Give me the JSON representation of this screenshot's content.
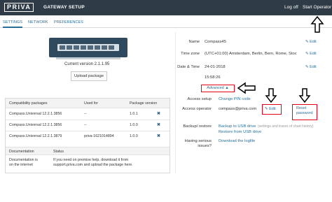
{
  "header": {
    "logo": "PRIVA",
    "title": "GATEWAY SETUP",
    "log_off": "Log off",
    "start_operator": "Start Operator"
  },
  "tabs": [
    {
      "label": "SETTINGS"
    },
    {
      "label": "NETWORK"
    },
    {
      "label": "PREFERENCES"
    }
  ],
  "device": {
    "current_version": "Current version 2.1.1.95",
    "upload_label": "Upload package"
  },
  "packages": {
    "headers": [
      "Compatibility packages",
      "Used for",
      "Package version"
    ],
    "rows": [
      {
        "name": "Compass.Universal 12.2.1.3856",
        "used_for": "--",
        "version": "1.0.1"
      },
      {
        "name": "Compass.Universal 12.2.1.3856",
        "used_for": "--",
        "version": "1.0.0"
      },
      {
        "name": "Compass.Universal 12.2.1.3879",
        "used_for": "priva-1621014894",
        "version": "1.0.0"
      }
    ]
  },
  "documentation": {
    "headers": [
      "Documentation",
      "Status"
    ],
    "label_line1": "Documentation is",
    "label_line2": "on the internet",
    "status_line1": "If you need on premise help, download it from",
    "status_line2": "support.priva.com and upload the package here."
  },
  "settings": {
    "name_label": "Name",
    "name_value": "Compass45",
    "timezone_label": "Time zone",
    "timezone_value": "(UTC+01:00) Amsterdam, Berlin, Bern, Rome, Stock",
    "datetime_label": "Date & Time",
    "date_value": "24-01-2018",
    "time_value": "15:58:26",
    "edit_label": "Edit",
    "advanced_label": "Advanced ▲",
    "access_setup_label": "Access setup",
    "access_setup_value": "Change PIN code",
    "access_operator_label": "Access operator",
    "access_operator_value": "compass@priva.com",
    "reset_line1": "Reset",
    "reset_line2": "password",
    "backup_label": "Backup/ restore",
    "backup_link": "Backup to USB drive",
    "backup_note": "(settings and traces of chart history)",
    "restore_link": "Restore from USB drive",
    "issues_label_line1": "Having serious",
    "issues_label_line2": "issues?",
    "logfile_link": "Download the logfile"
  },
  "colors": {
    "topbar": "#2f3b47",
    "link": "#2a6f97",
    "highlight": "#e3001b"
  }
}
